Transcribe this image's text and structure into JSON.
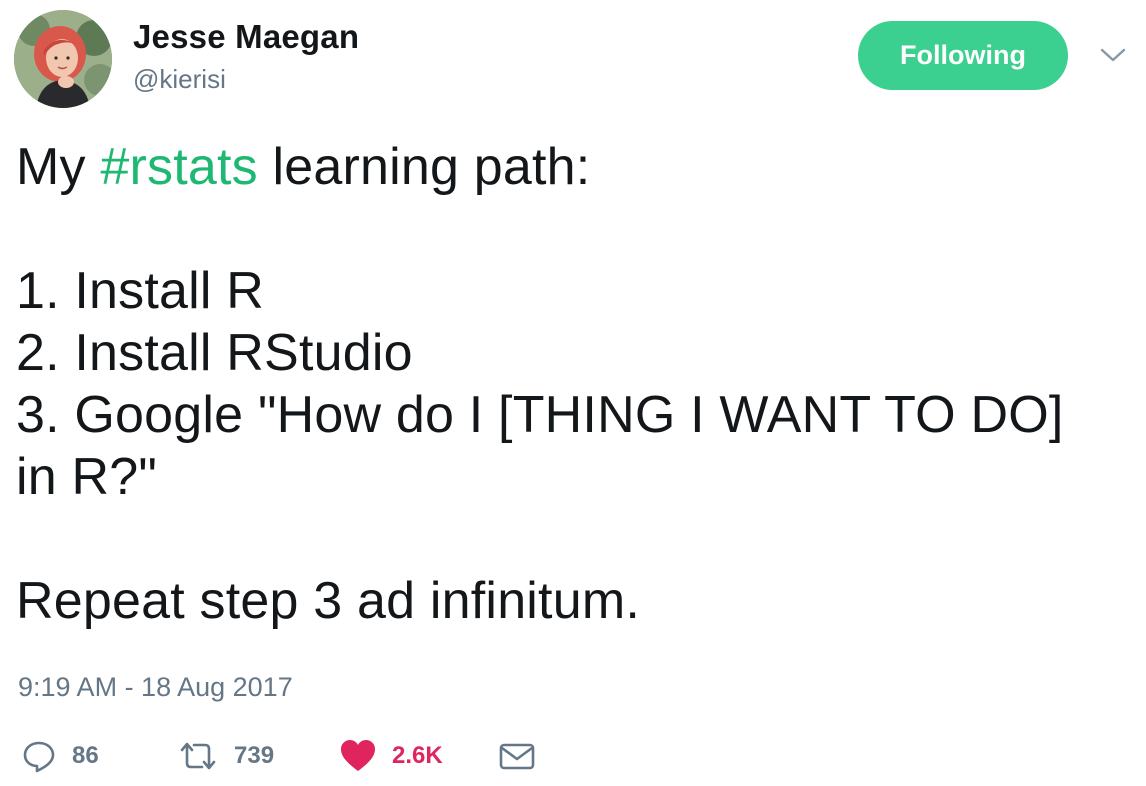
{
  "author": {
    "display_name": "Jesse Maegan",
    "handle": "@kierisi"
  },
  "follow_button": {
    "label": "Following",
    "color": "#3bd08f"
  },
  "menu": {
    "icon": "chevron-down-icon"
  },
  "tweet": {
    "line1_prefix": "My ",
    "hashtag": "#rstats",
    "line1_suffix": " learning path:",
    "step1": "1. Install R",
    "step2": "2. Install RStudio",
    "step3_a": "3. Google \"How do I [THING I WANT TO DO]",
    "step3_b": "in R?\"",
    "closing": "Repeat step 3 ad infinitum.",
    "hashtag_color": "#1fb872"
  },
  "timestamp": "9:19 AM - 18 Aug 2017",
  "actions": {
    "replies": "86",
    "retweets": "739",
    "likes": "2.6K",
    "like_color": "#e0245e",
    "icons": [
      "reply-icon",
      "retweet-icon",
      "heart-icon",
      "envelope-icon"
    ]
  }
}
